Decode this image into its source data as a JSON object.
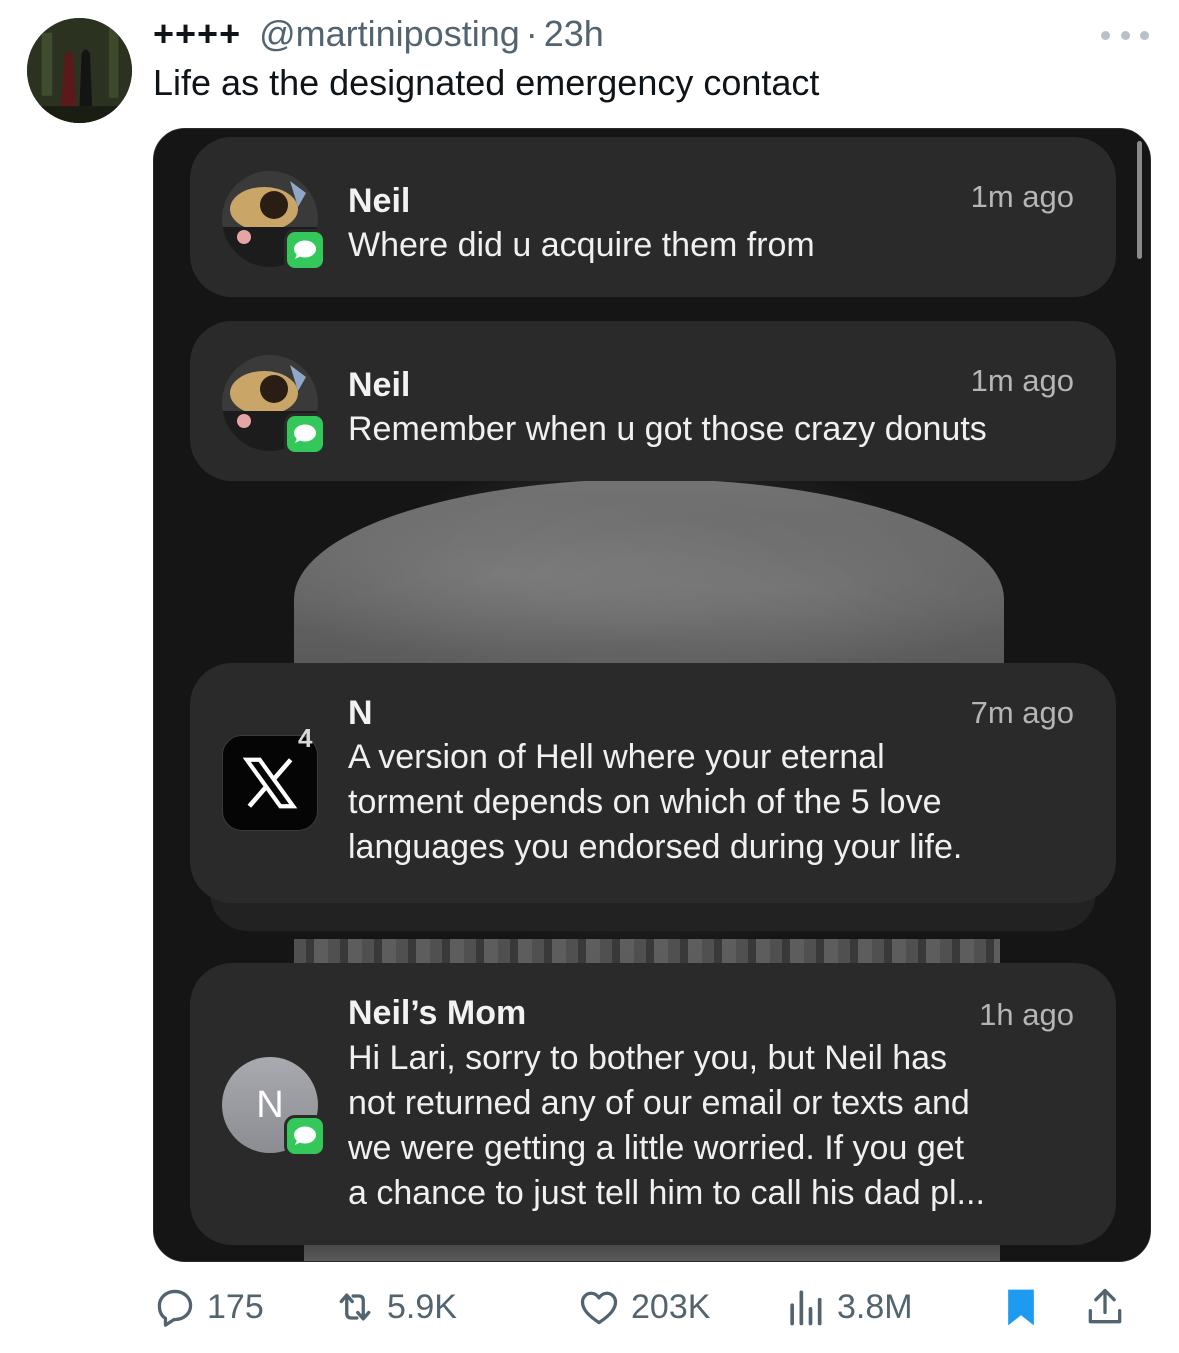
{
  "tweet": {
    "display_name": "++++",
    "handle": "@martiniposting",
    "separator": "·",
    "timestamp": "23h",
    "text": "Life as the designated emergency contact"
  },
  "media": {
    "notifications": [
      {
        "sender": "Neil",
        "time": "1m ago",
        "app_icon": "messages-icon",
        "body_lines": [
          "Where did u acquire them from"
        ]
      },
      {
        "sender": "Neil",
        "time": "1m ago",
        "app_icon": "messages-icon",
        "body_lines": [
          "Remember when u got those crazy donuts"
        ]
      },
      {
        "sender": "N",
        "time": "7m ago",
        "app_icon": "x-app-icon",
        "badge_count": "4",
        "body_lines": [
          "A version of Hell where your eternal",
          "torment depends on which of the 5 love",
          "languages you endorsed during your life."
        ]
      },
      {
        "sender": "Neil’s Mom",
        "time": "1h ago",
        "app_icon": "messages-icon",
        "avatar_initial": "N",
        "body_lines": [
          "Hi Lari, sorry to bother you, but Neil has",
          "not returned any of our email or texts and",
          "we were getting a little worried. If you get",
          "a chance to just tell him to call his dad pl..."
        ]
      }
    ]
  },
  "actions": {
    "replies": "175",
    "reposts": "5.9K",
    "likes": "203K",
    "views": "3.8M"
  },
  "colors": {
    "text_primary": "#0f1419",
    "text_secondary": "#536471",
    "bookmark_active": "#1d9bf0",
    "imessage_green": "#34c759",
    "notification_bg": "#2a2a2a"
  }
}
